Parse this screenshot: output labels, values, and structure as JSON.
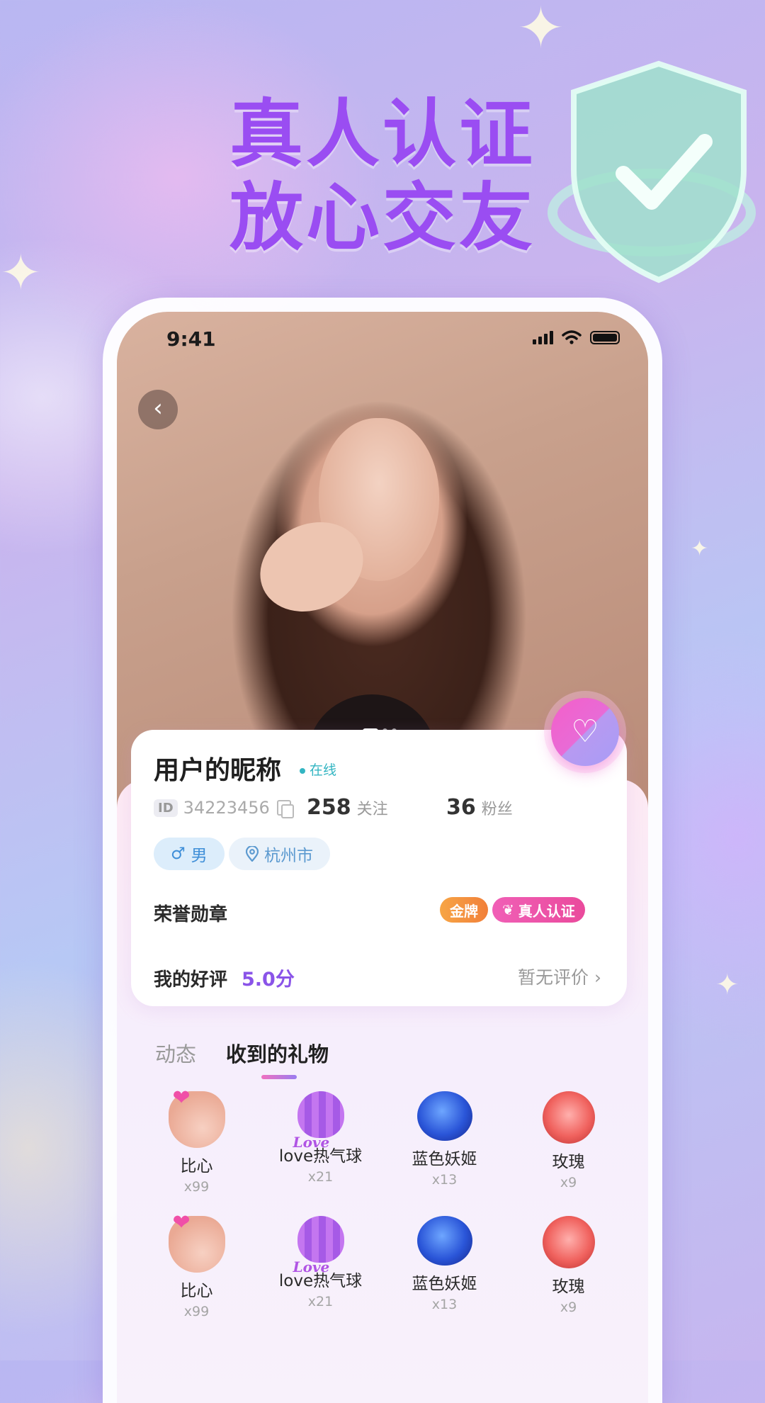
{
  "headline": {
    "line1": "真人认证",
    "line2": "放心交友"
  },
  "status_bar": {
    "time": "9:41"
  },
  "profile": {
    "nickname": "用户的昵称",
    "online_status": "在线",
    "id_label": "ID",
    "id_value": "34223456",
    "following_count": "258",
    "following_label": "关注",
    "fans_count": "36",
    "fans_label": "粉丝",
    "gender_symbol": "♂",
    "gender": "男",
    "city": "杭州市",
    "honor_label": "荣誉勋章",
    "badges": [
      "金牌",
      "真人认证"
    ],
    "rating_label": "我的好评",
    "rating_score": "5.0分",
    "rating_status": "暂无评价"
  },
  "photo_carousel": {
    "current_index": 1,
    "total": 3
  },
  "tabs": [
    {
      "label": "动态",
      "active": false
    },
    {
      "label": "收到的礼物",
      "active": true
    }
  ],
  "gifts": [
    {
      "name": "比心",
      "count": "x99",
      "icon": "finger-heart-icon"
    },
    {
      "name": "love热气球",
      "count": "x21",
      "icon": "balloon-icon"
    },
    {
      "name": "蓝色妖姬",
      "count": "x13",
      "icon": "blue-rose-icon"
    },
    {
      "name": "玫瑰",
      "count": "x9",
      "icon": "red-rose-icon"
    },
    {
      "name": "比心",
      "count": "x99",
      "icon": "finger-heart-icon"
    },
    {
      "name": "love热气球",
      "count": "x21",
      "icon": "balloon-icon"
    },
    {
      "name": "蓝色妖姬",
      "count": "x13",
      "icon": "blue-rose-icon"
    },
    {
      "name": "玫瑰",
      "count": "x9",
      "icon": "red-rose-icon"
    }
  ],
  "colors": {
    "headline": "#9a4df2",
    "accent": "#8a54e8",
    "online": "#33b5c2",
    "gold": "#f1803a",
    "verified": "#ea4a9c"
  }
}
